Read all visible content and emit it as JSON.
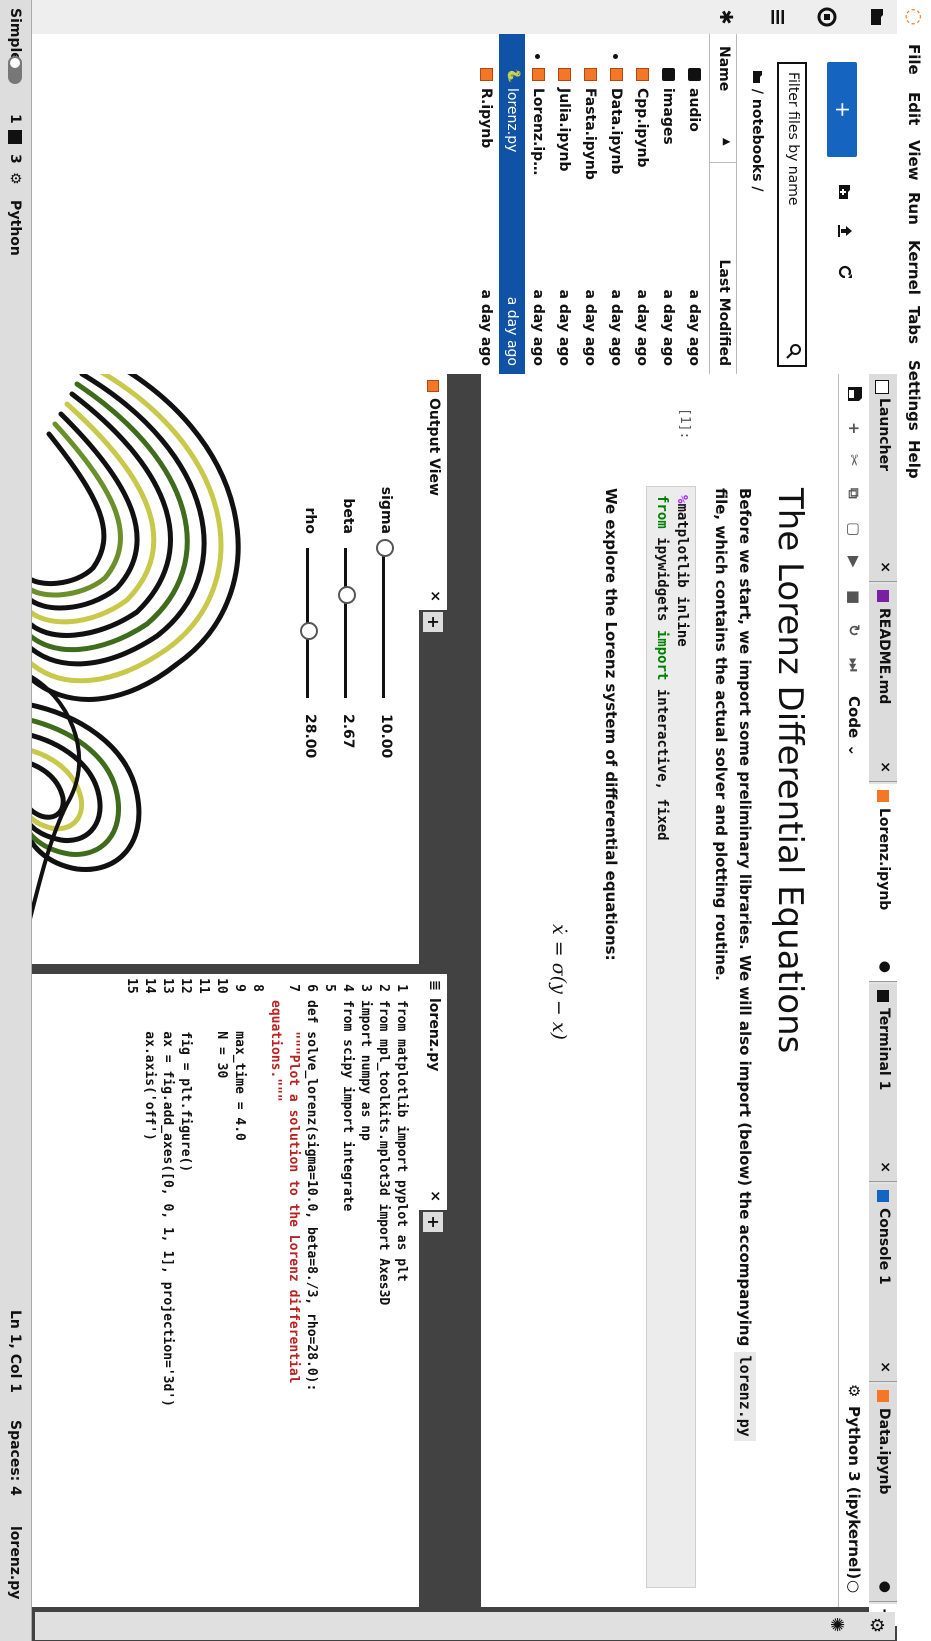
{
  "menu": [
    "File",
    "Edit",
    "View",
    "Run",
    "Kernel",
    "Tabs",
    "Settings",
    "Help"
  ],
  "filebrowser": {
    "new_label": "+",
    "filter_placeholder": "Filter files by name",
    "breadcrumb": "/ notebooks /",
    "col_name": "Name",
    "col_modified": "Last Modified",
    "files": [
      {
        "name": "audio",
        "modified": "a day ago",
        "type": "folder",
        "running": false,
        "selected": false
      },
      {
        "name": "images",
        "modified": "a day ago",
        "type": "folder",
        "running": false,
        "selected": false
      },
      {
        "name": "Cpp.ipynb",
        "modified": "a day ago",
        "type": "notebook",
        "running": false,
        "selected": false
      },
      {
        "name": "Data.ipynb",
        "modified": "a day ago",
        "type": "notebook",
        "running": true,
        "selected": false
      },
      {
        "name": "Fasta.ipynb",
        "modified": "a day ago",
        "type": "notebook",
        "running": false,
        "selected": false
      },
      {
        "name": "Julia.ipynb",
        "modified": "a day ago",
        "type": "notebook",
        "running": false,
        "selected": false
      },
      {
        "name": "Lorenz.ip…",
        "modified": "a day ago",
        "type": "notebook",
        "running": true,
        "selected": false
      },
      {
        "name": "lorenz.py",
        "modified": "a day ago",
        "type": "python",
        "running": false,
        "selected": true
      },
      {
        "name": "R.ipynb",
        "modified": "a day ago",
        "type": "notebook",
        "running": false,
        "selected": false
      }
    ]
  },
  "tabs": [
    {
      "label": "Launcher",
      "close": "×"
    },
    {
      "label": "README.md",
      "close": "×"
    },
    {
      "label": "Lorenz.ipynb",
      "close": "●"
    },
    {
      "label": "Terminal 1",
      "close": "×"
    },
    {
      "label": "Console 1",
      "close": "×"
    },
    {
      "label": "Data.ipynb",
      "close": "●"
    }
  ],
  "add_tab": "+",
  "notebook": {
    "cell_type": "Code",
    "kernel": "Python 3 (ipykernel)",
    "title": "The Lorenz Differential Equations",
    "para1_a": "Before we start, we import some preliminary libraries. We will also import (below) the accompanying",
    "para1_code": "lorenz.py",
    "para1_b": "file, which contains the actual solver and plotting routine.",
    "prompt": "[1]:",
    "code_line1": "matplotlib inline",
    "code_line2_from": "from",
    "code_line2_mod": " ipywidgets ",
    "code_line2_import": "import",
    "code_line2_rest": " interactive, fixed",
    "para2": "We explore the Lorenz system of differential equations:",
    "equation": "ẋ = σ(y − x)"
  },
  "output_view": {
    "tab_label": "Output View",
    "close": "×",
    "plus": "+",
    "sliders": [
      {
        "label": "sigma",
        "value": "10.00",
        "fraction": 0.0
      },
      {
        "label": "beta",
        "value": "2.67",
        "fraction": 0.31
      },
      {
        "label": "rho",
        "value": "28.00",
        "fraction": 0.55
      }
    ]
  },
  "editor": {
    "tab_label": "lorenz.py",
    "close": "×",
    "plus": "+",
    "lines": [
      {
        "n": "1",
        "t": "from matplotlib import pyplot as plt"
      },
      {
        "n": "2",
        "t": "from mpl_toolkits.mplot3d import Axes3D"
      },
      {
        "n": "3",
        "t": "import numpy as np"
      },
      {
        "n": "4",
        "t": "from scipy import integrate"
      },
      {
        "n": "5",
        "t": ""
      },
      {
        "n": "6",
        "t": "def solve_lorenz(sigma=10.0, beta=8./3, rho=28.0):"
      },
      {
        "n": "7",
        "t": "    \"\"\"Plot a solution to the Lorenz differential"
      },
      {
        "n": "",
        "t": "equations.\"\"\""
      },
      {
        "n": "8",
        "t": ""
      },
      {
        "n": "9",
        "t": "    max_time = 4.0"
      },
      {
        "n": "10",
        "t": "    N = 30"
      },
      {
        "n": "11",
        "t": ""
      },
      {
        "n": "12",
        "t": "    fig = plt.figure()"
      },
      {
        "n": "13",
        "t": "    ax = fig.add_axes([0, 0, 1, 1], projection='3d')"
      },
      {
        "n": "14",
        "t": "    ax.axis('off')"
      },
      {
        "n": "15",
        "t": ""
      }
    ]
  },
  "statusbar": {
    "mode": "Simple",
    "count1": "1",
    "count2": "3",
    "kernel": "Python",
    "position": "Ln 1, Col 1",
    "spaces": "Spaces: 4",
    "file": "lorenz.py"
  },
  "colors": {
    "accent": "#1565c0",
    "selected_row": "#1053a6",
    "notebook_icon": "#f37726",
    "plot_black": "#111111",
    "plot_green": "#3f6b1c",
    "plot_yellow": "#c8c84a"
  },
  "icons": [
    "jupyter-logo",
    "folder-icon",
    "running-icon",
    "command-palette-icon",
    "puzzle-icon",
    "new-folder-icon",
    "upload-icon",
    "refresh-icon",
    "search-icon",
    "save-icon",
    "add-cell-icon",
    "cut-icon",
    "copy-icon",
    "paste-icon",
    "run-icon",
    "stop-icon",
    "restart-icon",
    "fast-forward-icon",
    "gear-icon",
    "bug-icon"
  ]
}
